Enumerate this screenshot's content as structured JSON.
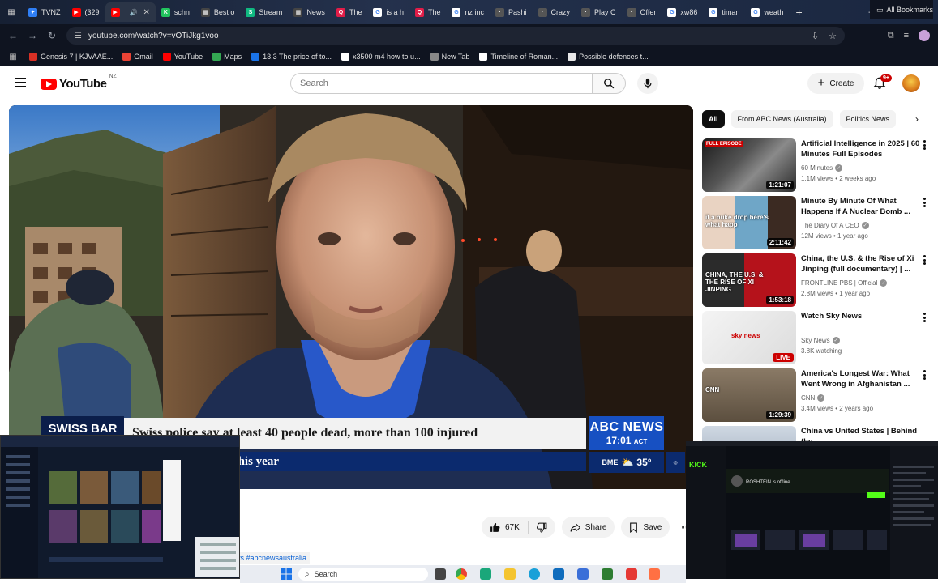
{
  "browser": {
    "tabs": [
      {
        "label": "TVNZ",
        "color": "#2f7ff5",
        "glyph": "+"
      },
      {
        "label": "(329",
        "color": "#ff0000",
        "glyph": "▶"
      },
      {
        "label": "",
        "color": "#ff0000",
        "glyph": "▶",
        "active": true
      },
      {
        "label": "schn",
        "color": "#22c55e",
        "glyph": "K"
      },
      {
        "label": "Best o",
        "color": "#444444",
        "glyph": "▦"
      },
      {
        "label": "Stream",
        "color": "#10b981",
        "glyph": "S"
      },
      {
        "label": "News",
        "color": "#444444",
        "glyph": "▦"
      },
      {
        "label": "The",
        "color": "#e11d48",
        "glyph": "Q"
      },
      {
        "label": "is a h",
        "color": "#ffffff",
        "glyph": "G"
      },
      {
        "label": "The",
        "color": "#e11d48",
        "glyph": "Q"
      },
      {
        "label": "nz inc",
        "color": "#ffffff",
        "glyph": "G"
      },
      {
        "label": "Pashi",
        "color": "#555555",
        "glyph": "·"
      },
      {
        "label": "Crazy",
        "color": "#555555",
        "glyph": "·"
      },
      {
        "label": "Play C",
        "color": "#555555",
        "glyph": "·"
      },
      {
        "label": "Offer",
        "color": "#555555",
        "glyph": "·"
      },
      {
        "label": "xw86",
        "color": "#ffffff",
        "glyph": "G"
      },
      {
        "label": "timan",
        "color": "#ffffff",
        "glyph": "G"
      },
      {
        "label": "weath",
        "color": "#ffffff",
        "glyph": "G"
      }
    ],
    "url": "youtube.com/watch?v=vOTiJkg1voo",
    "bookmarks": [
      {
        "label": "Genesis 7 | KJVAAE...",
        "color": "#d93025"
      },
      {
        "label": "Gmail",
        "color": "#ea4335"
      },
      {
        "label": "YouTube",
        "color": "#ff0000"
      },
      {
        "label": "Maps",
        "color": "#34a853"
      },
      {
        "label": "13.3 The price of to...",
        "color": "#1a73e8"
      },
      {
        "label": "x3500 m4 how to u...",
        "color": "#ffffff"
      },
      {
        "label": "New Tab",
        "color": "#888888"
      },
      {
        "label": "Timeline of Roman...",
        "color": "#ffffff"
      },
      {
        "label": "Possible defences t...",
        "color": "#e8e8e8"
      }
    ],
    "all_bookmarks": "All Bookmarks"
  },
  "youtube": {
    "logo_text": "YouTube",
    "country": "NZ",
    "search_placeholder": "Search",
    "create_label": "Create",
    "notif_badge": "9+"
  },
  "video": {
    "bar_label": "SWISS BAR",
    "headline": "Swiss police say at least 40 people dead, more than 100 injured",
    "ticker": "ed Dying legislation this year",
    "network": "ABC NEWS",
    "time": "17:01",
    "time_zone": "ACT",
    "weather_city": "BME",
    "weather_temp": "35°",
    "likes": "67K",
    "share_label": "Share",
    "save_label": "Save",
    "hashtags": "ws #abcnewsaustralia"
  },
  "sidebar": {
    "chips": [
      {
        "label": "All",
        "active": true
      },
      {
        "label": "From ABC News (Australia)"
      },
      {
        "label": "Politics News"
      }
    ],
    "recommendations": [
      {
        "title": "Artificial Intelligence in 2025 | 60 Minutes Full Episodes",
        "channel": "60 Minutes",
        "verified": true,
        "meta": "1.1M views • 2 weeks ago",
        "duration": "1:21:07",
        "badge": "FULL EPISODE",
        "thumb": "linear-gradient(135deg,#1b1b1b,#555 40%,#8a8a8a 60%,#2a2a2a)"
      },
      {
        "title": "Minute By Minute Of What Happens If A Nuclear Bomb ...",
        "channel": "The Diary Of A CEO",
        "verified": true,
        "meta": "12M views • 1 year ago",
        "duration": "2:11:42",
        "caption": "if a nuke drop here's what happ",
        "thumb": "linear-gradient(90deg,#e9d3c2 0 35%,#6fa6c7 35% 70%,#3b2a22 70%)"
      },
      {
        "title": "China, the U.S. & the Rise of Xi Jinping (full documentary) | ...",
        "channel": "FRONTLINE PBS | Official",
        "verified": true,
        "meta": "2.8M views • 1 year ago",
        "duration": "1:53:18",
        "caption": "CHINA, THE U.S. & THE RISE OF XI JINPING",
        "thumb": "linear-gradient(90deg,#2b2b2b 0 45%,#b5121b 45%)"
      },
      {
        "title": "Watch Sky News",
        "channel": "Sky News",
        "verified": true,
        "meta": "3.8K watching",
        "live": "LIVE",
        "caption": "sky news",
        "thumb": "linear-gradient(135deg,#f4f4f4,#dcdcdc)"
      },
      {
        "title": "America's Longest War: What Went Wrong in Afghanistan ...",
        "channel": "CNN",
        "verified": true,
        "meta": "3.4M views • 2 years ago",
        "duration": "1:29:39",
        "caption": "CNN",
        "thumb": "linear-gradient(180deg,#8a7a66,#5c4f3f)"
      },
      {
        "title": "China vs United States | Behind the ...",
        "channel": "",
        "verified": false,
        "meta": "",
        "thumb": "linear-gradient(180deg,#cfd8e3,#9aa7b5)"
      }
    ]
  },
  "taskbar": {
    "search_label": "Search"
  },
  "pip_right": {
    "app": "KICK",
    "user": "ROSHTEIN is offline"
  }
}
